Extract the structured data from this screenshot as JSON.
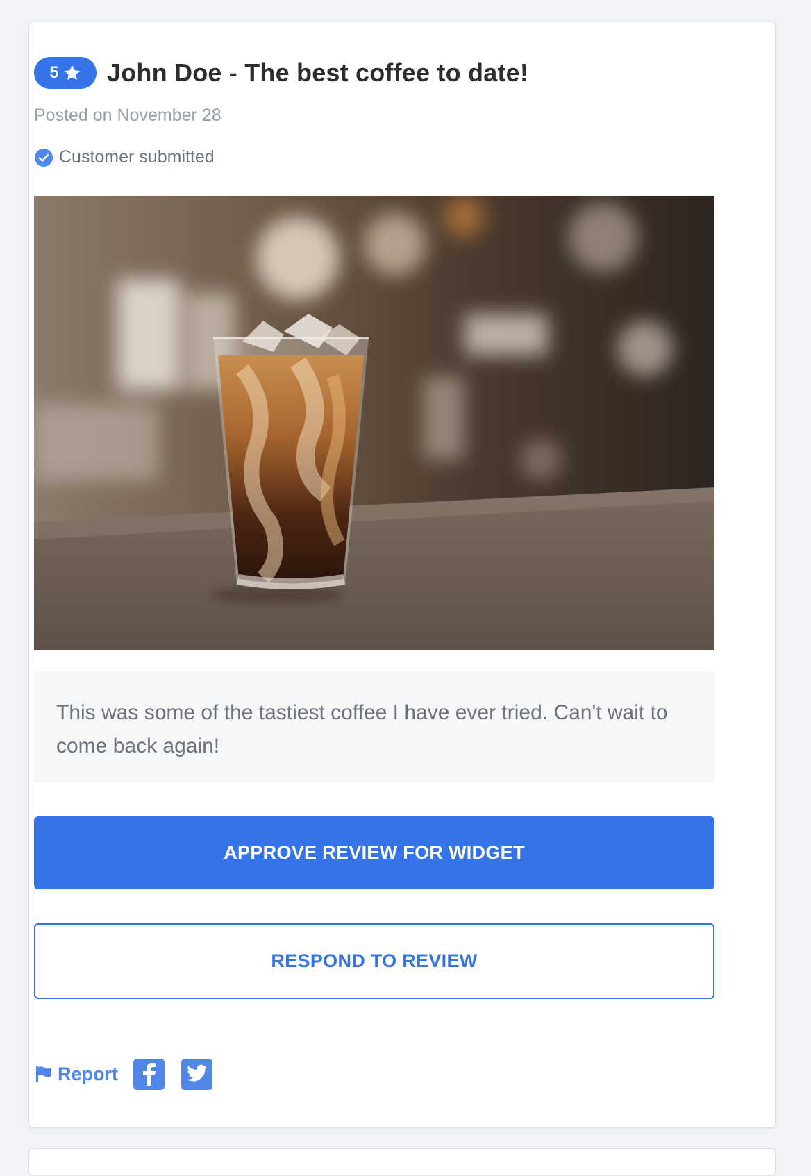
{
  "review": {
    "rating": "5",
    "title": "John Doe - The best coffee to date!",
    "posted": "Posted on November 28",
    "verified_label": "Customer submitted",
    "body": "This was some of the tastiest coffee I have ever tried. Can't wait to come back again!"
  },
  "actions": {
    "approve_label": "APPROVE REVIEW FOR WIDGET",
    "respond_label": "RESPOND TO REVIEW"
  },
  "footer": {
    "report_label": "Report",
    "icons": [
      "flag-icon",
      "facebook-icon",
      "twitter-icon"
    ]
  },
  "colors": {
    "accent": "#3474e8",
    "accent_light": "#4f86e8",
    "title": "#2b2d31",
    "muted": "#9aa1ab",
    "body_text": "#6c737d",
    "body_bg": "#f5f7f9",
    "page_bg": "#f1f3f6"
  }
}
